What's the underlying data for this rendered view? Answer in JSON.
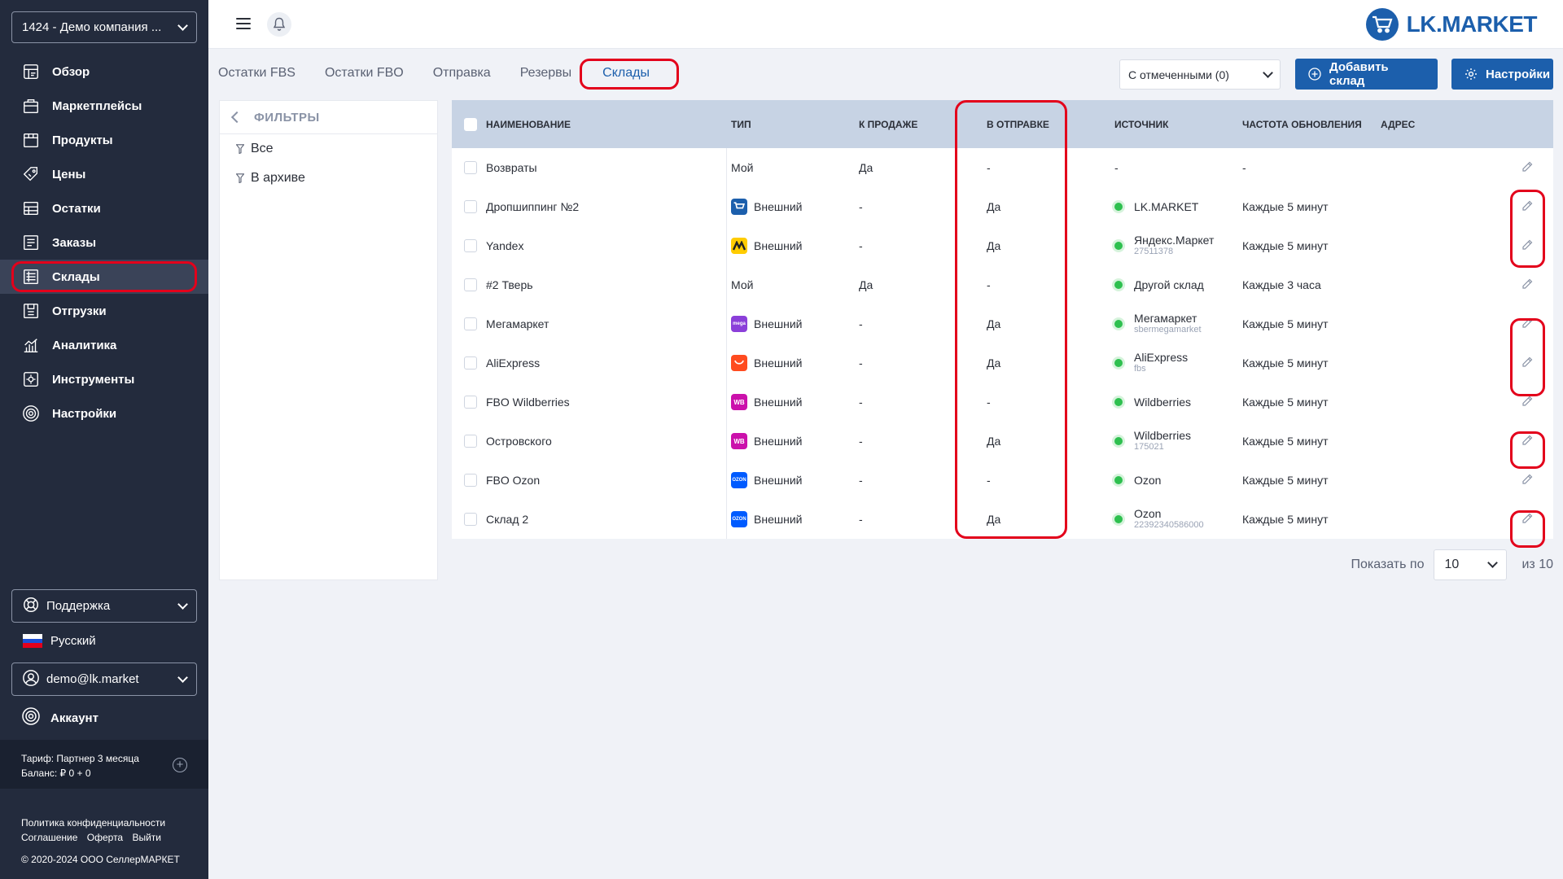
{
  "sidebar": {
    "company": "1424 - Демо компания ...",
    "nav": [
      {
        "label": "Обзор",
        "icon": "overview-icon"
      },
      {
        "label": "Маркетплейсы",
        "icon": "marketplaces-icon"
      },
      {
        "label": "Продукты",
        "icon": "products-icon"
      },
      {
        "label": "Цены",
        "icon": "prices-icon"
      },
      {
        "label": "Остатки",
        "icon": "stock-icon"
      },
      {
        "label": "Заказы",
        "icon": "orders-icon"
      },
      {
        "label": "Склады",
        "icon": "warehouse-icon",
        "active": true
      },
      {
        "label": "Отгрузки",
        "icon": "shipments-icon"
      },
      {
        "label": "Аналитика",
        "icon": "analytics-icon"
      },
      {
        "label": "Инструменты",
        "icon": "tools-icon"
      },
      {
        "label": "Настройки",
        "icon": "settings-icon"
      }
    ],
    "support": "Поддержка",
    "language": "Русский",
    "account_email": "demo@lk.market",
    "account_link": "Аккаунт",
    "tariff": "Тариф: Партнер 3 месяца",
    "balance": "Баланс: ₽ 0 + 0",
    "privacy": "Политика конфиденциальности",
    "footer_links": [
      "Соглашение",
      "Оферта",
      "Выйти"
    ],
    "copyright": "© 2020-2024 ООО СеллерМАРКЕТ"
  },
  "topbar": {
    "logo_text": "LK.MARKET"
  },
  "tabs": [
    {
      "label": "Остатки FBS"
    },
    {
      "label": "Остатки FBO"
    },
    {
      "label": "Отправка"
    },
    {
      "label": "Резервы"
    },
    {
      "label": "Склады",
      "active": true
    }
  ],
  "toolbar": {
    "bulk_action": "С отмеченными (0)",
    "add_label": "Добавить склад",
    "settings_label": "Настройки"
  },
  "filters": {
    "title": "ФИЛЬТРЫ",
    "items": [
      "Все",
      "В архиве"
    ]
  },
  "table": {
    "columns": {
      "name": "НАИМЕНОВАНИЕ",
      "type": "ТИП",
      "sale": "К ПРОДАЖЕ",
      "ship": "В ОТПРАВКЕ",
      "source": "ИСТОЧНИК",
      "freq": "ЧАСТОТА ОБНОВЛЕНИЯ",
      "addr": "АДРЕС"
    },
    "rows": [
      {
        "name": "Возвраты",
        "type": "Мой",
        "mp": "",
        "sale": "Да",
        "ship": "-",
        "source": "-",
        "source_sub": "",
        "status": false,
        "freq": "-"
      },
      {
        "name": "Дропшиппинг №2",
        "type": "Внешний",
        "mp": "lkmarket",
        "sale": "-",
        "ship": "Да",
        "source": "LK.MARKET",
        "source_sub": "",
        "status": true,
        "freq": "Каждые 5 минут"
      },
      {
        "name": "Yandex",
        "type": "Внешний",
        "mp": "yandex",
        "sale": "-",
        "ship": "Да",
        "source": "Яндекс.Маркет",
        "source_sub": "27511378",
        "status": true,
        "freq": "Каждые 5 минут"
      },
      {
        "name": "#2 Тверь",
        "type": "Мой",
        "mp": "",
        "sale": "Да",
        "ship": "-",
        "source": "Другой склад",
        "source_sub": "",
        "status": true,
        "freq": "Каждые 3 часа"
      },
      {
        "name": "Мегамаркет",
        "type": "Внешний",
        "mp": "megamarket",
        "sale": "-",
        "ship": "Да",
        "source": "Мегамаркет",
        "source_sub": "sbermegamarket",
        "status": true,
        "freq": "Каждые 5 минут"
      },
      {
        "name": "AliExpress",
        "type": "Внешний",
        "mp": "aliexpress",
        "sale": "-",
        "ship": "Да",
        "source": "AliExpress",
        "source_sub": "fbs",
        "status": true,
        "freq": "Каждые 5 минут"
      },
      {
        "name": "FBO Wildberries",
        "type": "Внешний",
        "mp": "wildberries",
        "sale": "-",
        "ship": "-",
        "source": "Wildberries",
        "source_sub": "",
        "status": true,
        "freq": "Каждые 5 минут"
      },
      {
        "name": "Островского",
        "type": "Внешний",
        "mp": "wildberries",
        "sale": "-",
        "ship": "Да",
        "source": "Wildberries",
        "source_sub": "175021",
        "status": true,
        "freq": "Каждые 5 минут"
      },
      {
        "name": "FBO Ozon",
        "type": "Внешний",
        "mp": "ozon",
        "sale": "-",
        "ship": "-",
        "source": "Ozon",
        "source_sub": "",
        "status": true,
        "freq": "Каждые 5 минут"
      },
      {
        "name": "Склад 2",
        "type": "Внешний",
        "mp": "ozon",
        "sale": "-",
        "ship": "Да",
        "source": "Ozon",
        "source_sub": "22392340586000",
        "status": true,
        "freq": "Каждые 5 минут"
      }
    ]
  },
  "pagination": {
    "label": "Показать по",
    "per_page": "10",
    "total": "из  10"
  },
  "colors": {
    "sidebar_bg": "#232b3d",
    "accent": "#1c5fac",
    "highlight": "#e3001b",
    "status_ok": "#2ec04f"
  }
}
